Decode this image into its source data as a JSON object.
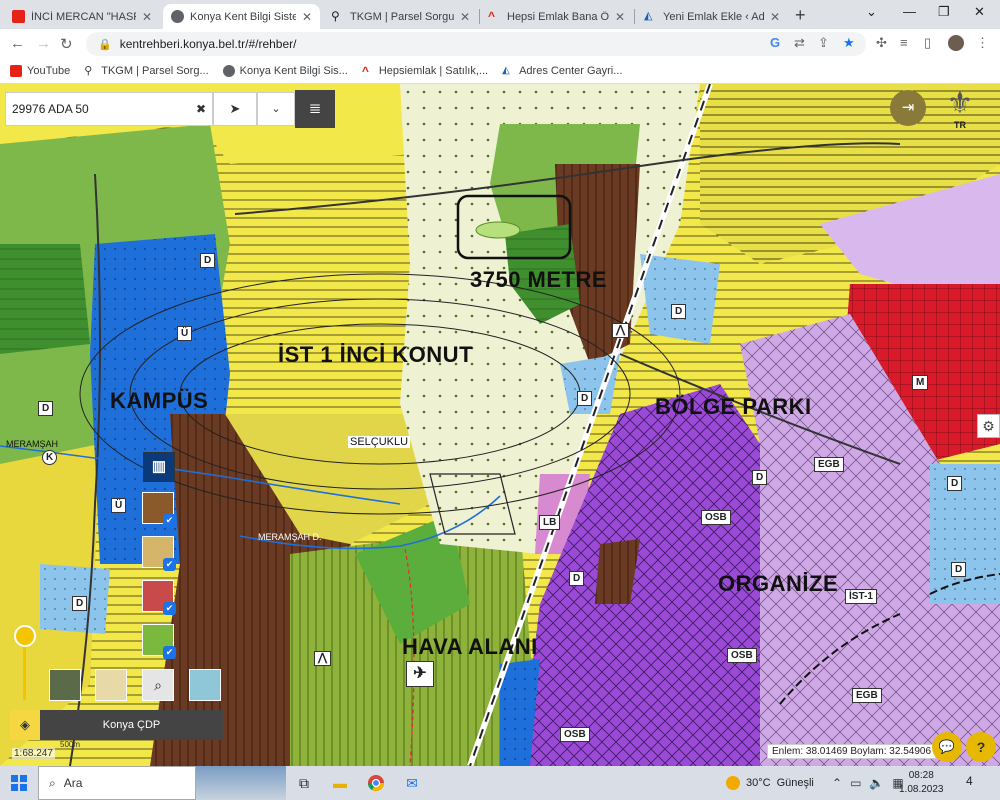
{
  "browser": {
    "tabs": [
      {
        "label": "İNCİ MERCAN \"HASRET",
        "icon": "youtube-icon",
        "active": false
      },
      {
        "label": "Konya Kent Bilgi Sistemi",
        "icon": "konya-kbs-icon",
        "active": true
      },
      {
        "label": "TKGM | Parsel Sorgu Uygu",
        "icon": "location-pin-icon",
        "active": false
      },
      {
        "label": "Hepsi Emlak Bana Özel",
        "icon": "hepsiemlak-icon",
        "active": false
      },
      {
        "label": "Yeni Emlak Ekle ‹ Adres Ce",
        "icon": "adres-center-icon",
        "active": false
      }
    ],
    "url": "kentrehberi.konya.bel.tr/#/rehber/",
    "bookmarks": [
      {
        "label": "YouTube",
        "icon": "youtube-icon"
      },
      {
        "label": "TKGM | Parsel Sorg...",
        "icon": "location-pin-icon"
      },
      {
        "label": "Konya Kent Bilgi Sis...",
        "icon": "konya-kbs-icon"
      },
      {
        "label": "Hepsiemlak | Satılık,...",
        "icon": "hepsiemlak-icon"
      },
      {
        "label": "Adres Center Gayri...",
        "icon": "adres-center-icon"
      }
    ]
  },
  "map": {
    "search_value": "29976 ADA 50",
    "emblem_text": "TR",
    "labels": {
      "area_3750": "3750 METRE",
      "ist1_konut": "İST 1 İNCİ KONUT",
      "kampus": "KAMPÜS",
      "bolge_parki": "BÖLGE PARKI",
      "organize": "ORGANİZE",
      "hava_alani": "HAVA ALANI",
      "selcuklu": "SELÇUKLU",
      "meramsah": "MERAMŞAH",
      "meramsah_d": "MERAMŞAH D.",
      "ist1": "İST-1"
    },
    "badges": {
      "d": "D",
      "u": "Ü",
      "k": "K",
      "m": "M",
      "lb": "LB",
      "egb": "EGB",
      "osb": "OSB"
    },
    "layer_name": "Konya ÇDP",
    "scale": "1:68.247",
    "scalebar": "500m",
    "coordinates": "Enlem: 38.01469 Boylam: 32.54906",
    "colors": {
      "residential": "#f2e84a",
      "industry": "#9a4ad6",
      "park": "#6db33f",
      "commercial": "#d91a2a",
      "education": "#1e6fd9",
      "forest": "#6b3a22"
    }
  },
  "taskbar": {
    "search_placeholder": "Ara",
    "temperature": "30°C",
    "weather": "Güneşli",
    "time": "08:28",
    "date": "1.08.2023",
    "notifications": "4"
  }
}
